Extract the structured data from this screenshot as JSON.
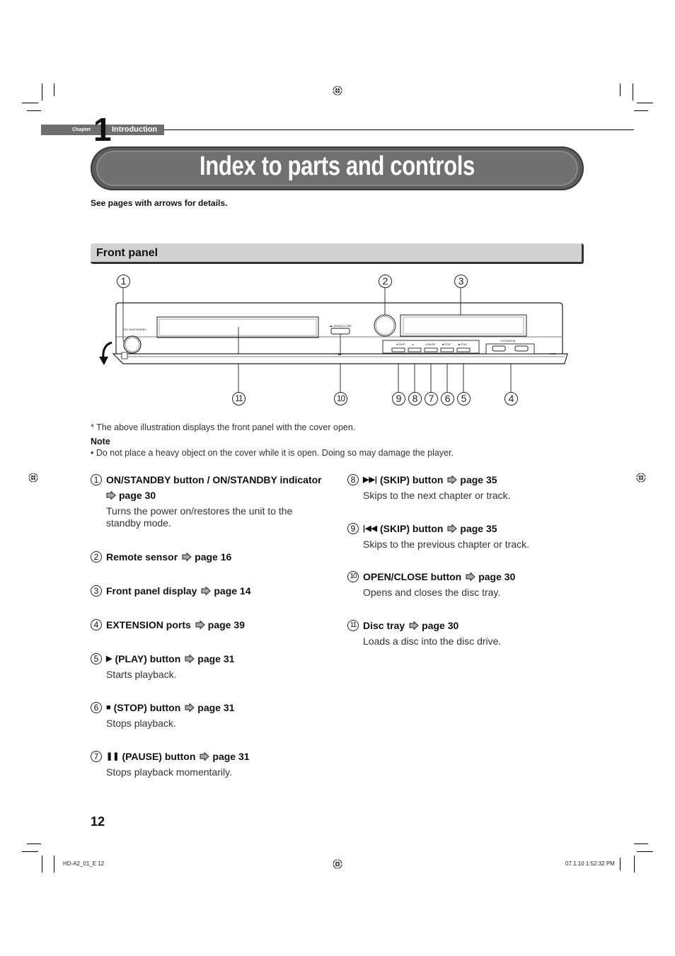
{
  "chapter": {
    "word": "Chapter",
    "number": "1",
    "title": "Introduction"
  },
  "page_title": "Index to parts and controls",
  "subtitle": "See pages with arrows for details.",
  "section": {
    "label": "Front panel"
  },
  "diagram": {
    "callouts": [
      "1",
      "2",
      "3",
      "4",
      "5",
      "6",
      "7",
      "8",
      "9",
      "10",
      "11"
    ],
    "panel_labels": {
      "on_standby": "I/⏻ ON/STANDBY",
      "open_close": "⏏ OPEN/CLOSE",
      "skip_prev": "⏮ SKIP",
      "skip_next": "⏭",
      "pause": "⏸ PAUSE",
      "stop": "■ STOP",
      "play": "▶ PLAY",
      "extension": "EXTENSION"
    }
  },
  "footnote": "* The above illustration displays the front panel with the cover open.",
  "note": {
    "heading": "Note",
    "text": "• Do not place a heavy object on the cover while it is open. Doing so may damage the player."
  },
  "items": [
    {
      "num": "1",
      "glyph": "",
      "title": "ON/STANDBY button / ON/STANDBY indicator",
      "page": "page 30",
      "desc": "Turns the power on/restores the unit to the standby mode."
    },
    {
      "num": "2",
      "glyph": "",
      "title": "Remote sensor",
      "page": "page 16",
      "desc": ""
    },
    {
      "num": "3",
      "glyph": "",
      "title": "Front panel display",
      "page": "page 14",
      "desc": ""
    },
    {
      "num": "4",
      "glyph": "",
      "title": "EXTENSION ports",
      "page": "page 39",
      "desc": ""
    },
    {
      "num": "5",
      "glyph": "▶",
      "title": "(PLAY) button",
      "page": "page 31",
      "desc": "Starts playback."
    },
    {
      "num": "6",
      "glyph": "■",
      "title": "(STOP) button",
      "page": "page 31",
      "desc": "Stops playback."
    },
    {
      "num": "7",
      "glyph": "❚❚",
      "title": "(PAUSE) button",
      "page": "page 31",
      "desc": "Stops playback momentarily."
    },
    {
      "num": "8",
      "glyph": "▶▶|",
      "title": "(SKIP) button",
      "page": "page 35",
      "desc": "Skips to the next chapter or track."
    },
    {
      "num": "9",
      "glyph": "|◀◀",
      "title": "(SKIP) button",
      "page": "page 35",
      "desc": "Skips to the previous chapter or track."
    },
    {
      "num": "10",
      "glyph": "",
      "title": "OPEN/CLOSE button",
      "page": "page 30",
      "desc": "Opens and closes the disc tray."
    },
    {
      "num": "11",
      "glyph": "",
      "title": "Disc tray",
      "page": "page 30",
      "desc": "Loads a disc into the disc drive."
    }
  ],
  "page_number": "12",
  "footer": {
    "left": "HD-A2_01_E   12",
    "right": "07.1.10   1:52:32 PM"
  }
}
